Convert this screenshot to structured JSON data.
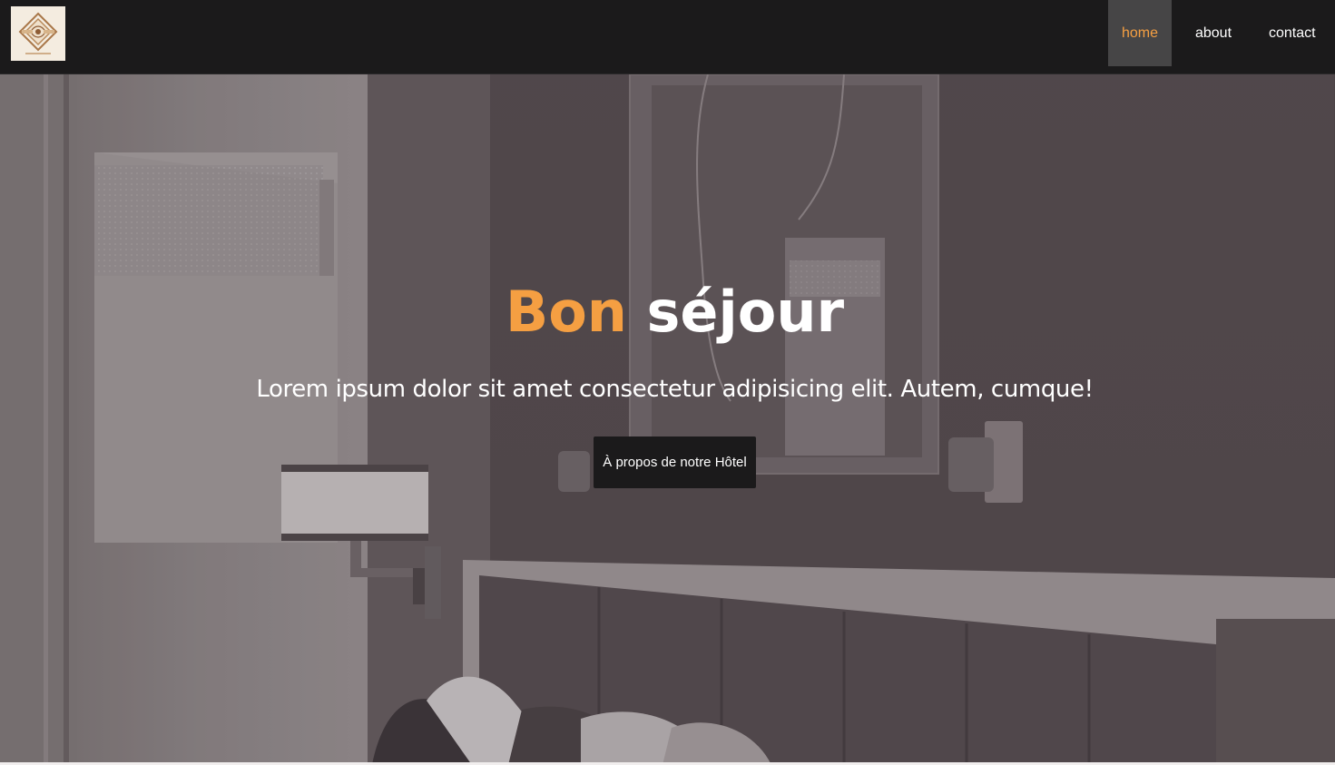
{
  "nav": {
    "logo_alt": "Hotel logo",
    "items": [
      {
        "label": "home",
        "active": true
      },
      {
        "label": "about",
        "active": false
      },
      {
        "label": "contact",
        "active": false
      }
    ]
  },
  "hero": {
    "title_accent": "Bon",
    "title_rest": "séjour",
    "subtitle": "Lorem ipsum dolor sit amet consectetur adipisicing elit. Autem, cumque!",
    "button_label": "À propos de notre Hôtel"
  },
  "colors": {
    "accent": "#f59f42",
    "navbar_bg": "#1b1a1b",
    "active_nav_bg": "#464546",
    "hero_overlay": "#4d4548"
  },
  "icons": {
    "logo": "ornamental-hotel-crest-icon"
  }
}
